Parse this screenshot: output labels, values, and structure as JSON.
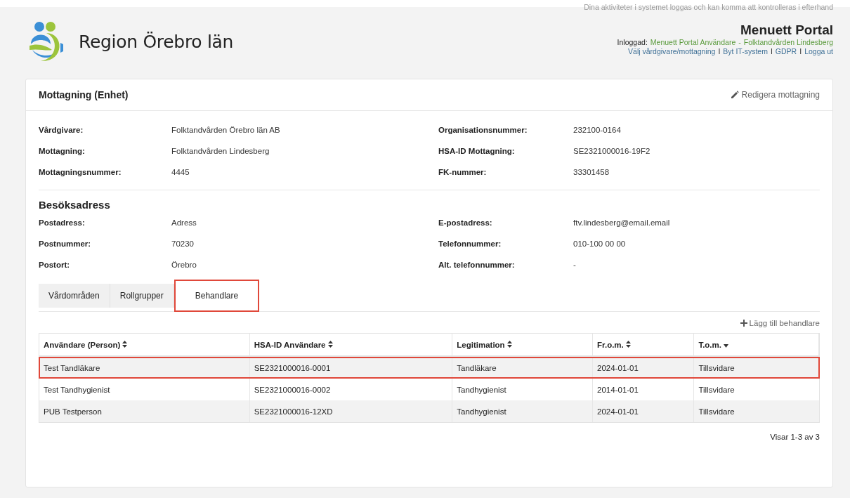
{
  "header": {
    "notice": "Dina aktiviteter i systemet loggas och kan komma att kontrolleras i efterhand",
    "org_name": "Region Örebro län",
    "portal_title": "Menuett Portal",
    "logged_in_label": "Inloggad:",
    "logged_in_user": "Menuett Portal Användare",
    "logged_in_separator": "-",
    "logged_in_unit": "Folktandvården Lindesberg",
    "links": [
      {
        "label": "Välj vårdgivare/mottagning"
      },
      {
        "separator": "I",
        "label": "Byt IT-system"
      },
      {
        "separator": "I",
        "label": "GDPR"
      },
      {
        "separator": "I",
        "label": "Logga ut"
      }
    ]
  },
  "card": {
    "title": "Mottagning (Enhet)",
    "edit_action": "Redigera mottagning",
    "unit_fields": [
      {
        "label": "Vårdgivare:",
        "value": "Folktandvården Örebro län AB"
      },
      {
        "label": "Organisationsnummer:",
        "value": "232100-0164"
      },
      {
        "label": "Mottagning:",
        "value": "Folktandvården Lindesberg"
      },
      {
        "label": "HSA-ID Mottagning:",
        "value": "SE2321000016-19F2"
      },
      {
        "label": "Mottagningsnummer:",
        "value": "4445"
      },
      {
        "label": "FK-nummer:",
        "value": "33301458"
      }
    ],
    "address_title": "Besöksadress",
    "address_fields": [
      {
        "label": "Postadress:",
        "value": "Adress"
      },
      {
        "label": "E-postadress:",
        "value": "ftv.lindesberg@email.email"
      },
      {
        "label": "Postnummer:",
        "value": "70230"
      },
      {
        "label": "Telefonnummer:",
        "value": "010-100 00 00"
      },
      {
        "label": "Postort:",
        "value": "Örebro"
      },
      {
        "label": "Alt. telefonnummer:",
        "value": "-"
      }
    ],
    "tabs": [
      {
        "label": "Vårdområden",
        "selected": false,
        "highlighted": false
      },
      {
        "label": "Rollgrupper",
        "selected": false,
        "highlighted": false
      },
      {
        "label": "Behandlare",
        "selected": true,
        "highlighted": true
      }
    ],
    "add_action": "Lägg till behandlare",
    "table": {
      "columns": [
        {
          "label": "Användare (Person)",
          "kind": "sortable"
        },
        {
          "label": "HSA-ID Användare",
          "kind": "sortable"
        },
        {
          "label": "Legitimation",
          "kind": "sortable"
        },
        {
          "label": "Fr.o.m.",
          "kind": "sortable"
        },
        {
          "label": "T.o.m.",
          "kind": "descending"
        }
      ],
      "rows": [
        {
          "cells": [
            "Test Tandläkare",
            "SE2321000016-0001",
            "Tandläkare",
            "2024-01-01",
            "Tillsvidare"
          ],
          "highlighted": true
        },
        {
          "cells": [
            "Test Tandhygienist",
            "SE2321000016-0002",
            "Tandhygienist",
            "2014-01-01",
            "Tillsvidare"
          ],
          "highlighted": false
        },
        {
          "cells": [
            "PUB Testperson",
            "SE2321000016-12XD",
            "Tandhygienist",
            "2024-01-01",
            "Tillsvidare"
          ],
          "highlighted": false
        }
      ]
    },
    "pagination": "Visar 1-3 av 3"
  }
}
